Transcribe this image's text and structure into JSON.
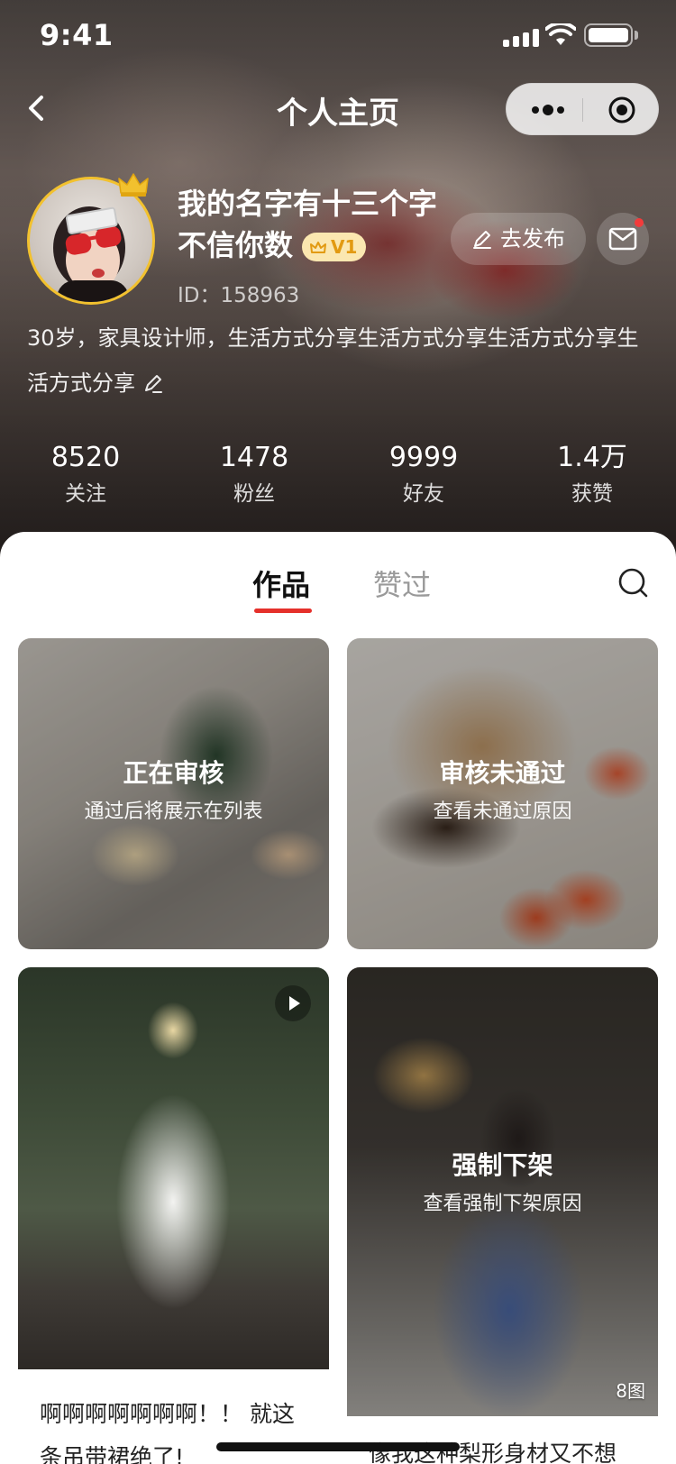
{
  "status_bar": {
    "time": "9:41"
  },
  "nav": {
    "title": "个人主页"
  },
  "profile": {
    "nickname": "我的名字有十三个字不信你数",
    "vip_level": "V1",
    "id_label": "ID：",
    "id_value": "158963",
    "bio": "30岁，家具设计师，生活方式分享生活方式分享生活方式分享生活方式分享",
    "publish_label": "去发布"
  },
  "stats": [
    {
      "value": "8520",
      "label": "关注"
    },
    {
      "value": "1478",
      "label": "粉丝"
    },
    {
      "value": "9999",
      "label": "好友"
    },
    {
      "value": "1.4万",
      "label": "获赞"
    }
  ],
  "tabs": {
    "works": "作品",
    "liked": "赞过"
  },
  "cards": [
    {
      "status_title": "正在审核",
      "status_sub": "通过后将展示在列表"
    },
    {
      "status_title": "审核未通过",
      "status_sub": "查看未通过原因"
    },
    {
      "title": "啊啊啊啊啊啊啊！！ 就这条吊带裙绝了!"
    },
    {
      "status_title": "强制下架",
      "status_sub": "查看强制下架原因",
      "image_count": "8图",
      "title": "像我这种梨形身材又不想"
    }
  ],
  "colors": {
    "accent": "#e5302b",
    "vip_badge_bg": "#fbe7b0",
    "vip_badge_text": "#e29a12",
    "avatar_border": "#f2c12e"
  }
}
